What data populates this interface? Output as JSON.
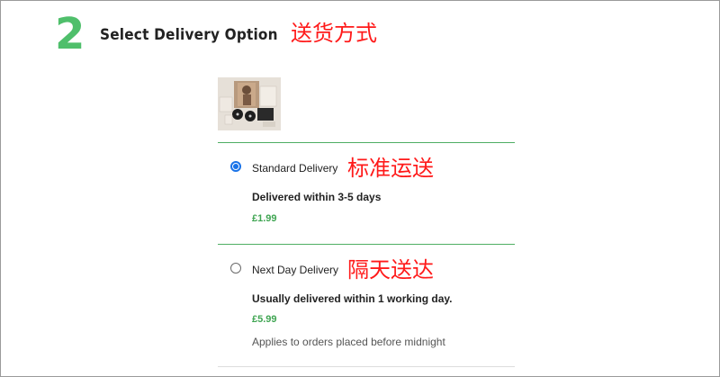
{
  "step": {
    "number": "2",
    "title": "Select Delivery Option",
    "annotation": "送货方式"
  },
  "delivery_options": [
    {
      "label": "Standard Delivery",
      "annotation": "标准运送",
      "description": "Delivered within 3-5 days",
      "price": "£1.99",
      "selected": true
    },
    {
      "label": "Next Day Delivery",
      "annotation": "隔天送达",
      "description": "Usually delivered within 1 working day.",
      "price": "£5.99",
      "note": "Applies to orders placed before midnight",
      "selected": false
    }
  ],
  "colors": {
    "accent_green": "#4fbf6b",
    "price_green": "#3fa552",
    "annotation_red": "#ff1a1a",
    "radio_blue": "#1a73e8"
  }
}
